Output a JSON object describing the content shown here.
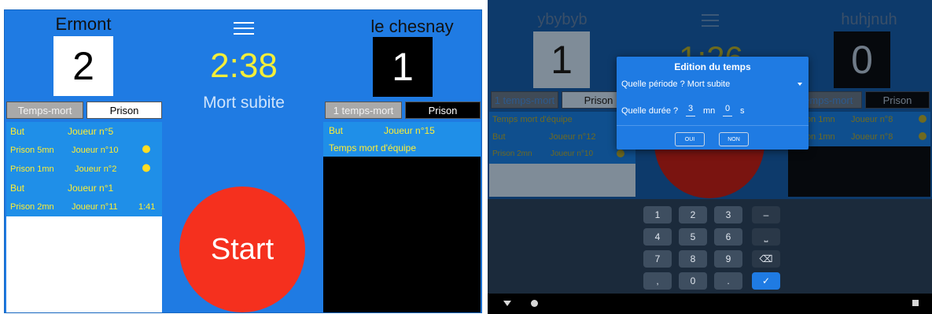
{
  "left_screen": {
    "team_left": {
      "name": "Ermont",
      "score": "2"
    },
    "team_right": {
      "name": "le chesnay",
      "score": "1"
    },
    "timer": "2:38",
    "period": "Mort subite",
    "start_label": "Start",
    "left_tabs": {
      "timeout": "Temps-mort",
      "prison": "Prison"
    },
    "right_tabs": {
      "timeout": "1 temps-mort",
      "prison": "Prison"
    },
    "left_events": [
      {
        "type": "But",
        "player": "Joueur n°5",
        "extra": ""
      },
      {
        "type": "Prison 5mn",
        "player": "Joueur n°10",
        "extra": "stopwatch"
      },
      {
        "type": "Prison 1mn",
        "player": "Joueur n°2",
        "extra": "stopwatch"
      },
      {
        "type": "But",
        "player": "Joueur n°1",
        "extra": ""
      },
      {
        "type": "Prison 2mn",
        "player": "Joueur n°11",
        "extra": "1:41"
      }
    ],
    "right_events": [
      {
        "type": "But",
        "player": "Joueur n°15"
      },
      {
        "type": "Temps mort d'équipe",
        "player": ""
      }
    ]
  },
  "right_screen": {
    "team_left": {
      "name": "ybybyb",
      "score": "1"
    },
    "team_right": {
      "name": "huhjnuh",
      "score": "0"
    },
    "timer_partial": "1:26",
    "bg_tabs_left": {
      "timeout": "1 temps-mort",
      "prison": "Prison"
    },
    "bg_tabs_right": {
      "timeout": "Temps-mort",
      "prison": "Prison"
    },
    "bg_left_events": [
      {
        "type": "Temps mort d'équipe",
        "player": ""
      },
      {
        "type": "But",
        "player": "Joueur n°12"
      },
      {
        "type": "Prison 2mn",
        "player": "Joueur n°10"
      }
    ],
    "bg_right_events": [
      {
        "type": "Prison 1mn",
        "player": "Joueur n°8"
      },
      {
        "type": "Prison 1mn",
        "player": "Joueur n°8"
      }
    ],
    "dialog": {
      "title": "Edition du temps",
      "period_label": "Quelle période ? Mort subite",
      "duration_label": "Quelle durée ?",
      "minutes_value": "3",
      "minutes_unit": "mn",
      "seconds_value": "0",
      "seconds_unit": "s",
      "yes_label": "OUI",
      "no_label": "NON"
    },
    "keypad": [
      [
        "1",
        "2",
        "3",
        "–"
      ],
      [
        "4",
        "5",
        "6",
        "⎵"
      ],
      [
        "7",
        "8",
        "9",
        "⌫"
      ],
      [
        ",",
        "0",
        ".",
        "✓"
      ]
    ]
  },
  "colors": {
    "app_blue": "#1f7be3",
    "timer_yellow": "#f2ee3a",
    "start_red": "#f5301e",
    "event_yellow": "#ffee33",
    "dark_bg": "#132234"
  }
}
